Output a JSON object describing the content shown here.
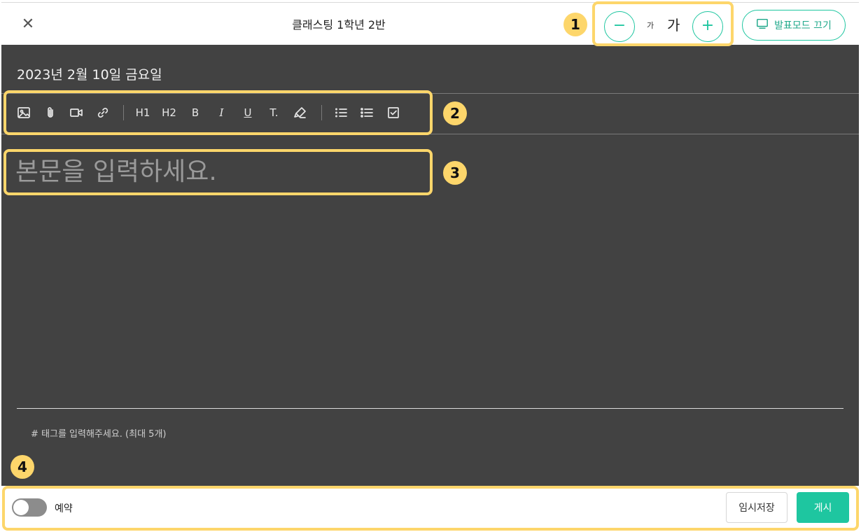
{
  "header": {
    "close_icon": "close-icon",
    "title": "클래스팅 1학년 2반",
    "font_decrease": "−",
    "font_increase": "+",
    "font_small": "가",
    "font_large": "가",
    "present_mode_label": "발표모드 끄기"
  },
  "editor": {
    "date": "2023년 2월 10일 금요일",
    "toolbar": {
      "h1": "H1",
      "h2": "H2",
      "bold": "B",
      "italic": "I",
      "underline": "U",
      "text_size": "T."
    },
    "body_placeholder": "본문을 입력하세요.",
    "tag_placeholder": "# 태그를 입력해주세요. (최대 5개)"
  },
  "footer": {
    "schedule_label": "예약",
    "draft_label": "임시저장",
    "post_label": "게시"
  },
  "annotations": {
    "badges": [
      "1",
      "2",
      "3",
      "4"
    ]
  },
  "colors": {
    "accent": "#1ec6a0",
    "editor_bg": "#424242",
    "highlight": "#fdd66b"
  }
}
